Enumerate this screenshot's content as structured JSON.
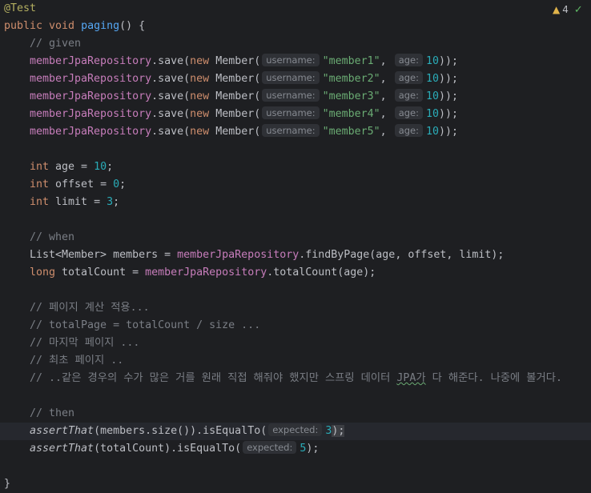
{
  "editor": {
    "annotation": "@Test",
    "method_modifiers": "public void ",
    "method_name": "paging",
    "method_tail": "() {",
    "comment_given": "// given",
    "save_calls": [
      {
        "field": "memberJpaRepository",
        "method": ".save(",
        "kw": "new",
        "cls": " Member(",
        "hint_username": "username:",
        "value": "\"member1\"",
        "sep": ", ",
        "hint_age": "age:",
        "age": "10",
        "end": "));"
      },
      {
        "field": "memberJpaRepository",
        "method": ".save(",
        "kw": "new",
        "cls": " Member(",
        "hint_username": "username:",
        "value": "\"member2\"",
        "sep": ", ",
        "hint_age": "age:",
        "age": "10",
        "end": "));"
      },
      {
        "field": "memberJpaRepository",
        "method": ".save(",
        "kw": "new",
        "cls": " Member(",
        "hint_username": "username:",
        "value": "\"member3\"",
        "sep": ", ",
        "hint_age": "age:",
        "age": "10",
        "end": "));"
      },
      {
        "field": "memberJpaRepository",
        "method": ".save(",
        "kw": "new",
        "cls": " Member(",
        "hint_username": "username:",
        "value": "\"member4\"",
        "sep": ", ",
        "hint_age": "age:",
        "age": "10",
        "end": "));"
      },
      {
        "field": "memberJpaRepository",
        "method": ".save(",
        "kw": "new",
        "cls": " Member(",
        "hint_username": "username:",
        "value": "\"member5\"",
        "sep": ", ",
        "hint_age": "age:",
        "age": "10",
        "end": "));"
      }
    ],
    "vars": [
      {
        "type": "int",
        "name": " age = ",
        "value": "10",
        "end": ";"
      },
      {
        "type": "int",
        "name": " offset = ",
        "value": "0",
        "end": ";"
      },
      {
        "type": "int",
        "name": " limit = ",
        "value": "3",
        "end": ";"
      }
    ],
    "comment_when": "// when",
    "list_decl": "List<Member> members = ",
    "repo_field": "memberJpaRepository",
    "find_call": ".findByPage(age, offset, limit);",
    "long_kw": "long",
    "total_decl": " totalCount = ",
    "count_call": ".totalCount(age);",
    "comments": [
      "// 페이지 계산 적용...",
      "// totalPage = totalCount / size ...",
      "// 마지막 페이지 ...",
      "// 최초 페이지 .."
    ],
    "long_comment_pre": "// ..같은 경우의 수가 많은 거를 원래 직접 해줘야 했지만 스프링 데이터 ",
    "long_comment_jpa": "JPA가",
    "long_comment_post": " 다 해준다. 나중에 볼거다.",
    "comment_then": "// then",
    "assert1": {
      "fn": "assertThat",
      "args": "(members.size()).isEqualTo(",
      "hint": "expected:",
      "value": "3",
      "end": ");"
    },
    "assert2": {
      "fn": "assertThat",
      "args": "(totalCount).isEqualTo(",
      "hint": "expected:",
      "value": "5",
      "end": ");"
    },
    "closing": "}"
  },
  "inspections": {
    "warning_count": "4",
    "warning_icon": "warning-triangle-icon",
    "ok_icon": "check-icon"
  }
}
